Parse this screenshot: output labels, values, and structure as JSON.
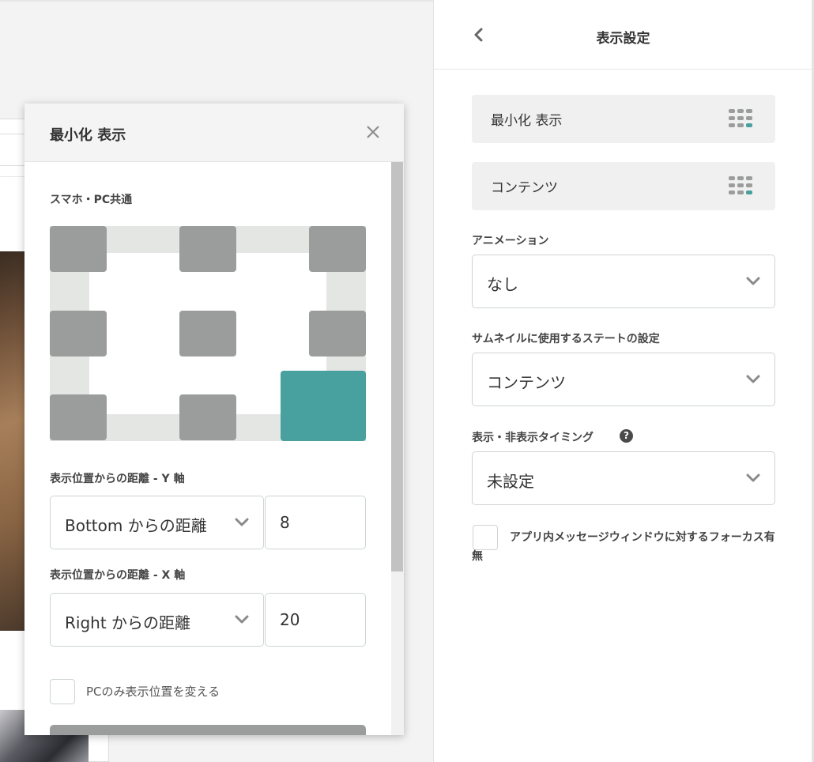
{
  "right_panel": {
    "title": "表示設定",
    "layers": [
      {
        "label": "最小化 表示"
      },
      {
        "label": "コンテンツ"
      }
    ],
    "animation": {
      "label": "アニメーション",
      "value": "なし"
    },
    "thumbnail_state": {
      "label": "サムネイルに使用するステートの設定",
      "value": "コンテンツ"
    },
    "timing": {
      "label": "表示・非表示タイミング",
      "value": "未設定",
      "help_glyph": "?"
    },
    "focus_checkbox": {
      "label": "アプリ内メッセージウィンドウに対するフォーカス有無",
      "checked": false
    }
  },
  "dialog": {
    "title": "最小化 表示",
    "close_glyph": "×",
    "section_label": "スマホ・PC共通",
    "position_grid": {
      "positions": [
        "top-left",
        "top-center",
        "top-right",
        "middle-left",
        "middle-center",
        "middle-right",
        "bottom-left",
        "bottom-center",
        "bottom-right"
      ],
      "selected": "bottom-right"
    },
    "y_axis": {
      "label": "表示位置からの距離 - Y 軸",
      "select_value": "Bottom からの距離",
      "input_value": "8"
    },
    "x_axis": {
      "label": "表示位置からの距離 - X 軸",
      "select_value": "Right からの距離",
      "input_value": "20"
    },
    "pc_checkbox": {
      "label": "PCのみ表示位置を変える",
      "checked": false
    }
  },
  "colors": {
    "accent": "#48a09f",
    "tile": "#9a9d9c",
    "frame": "#e4e6e4"
  }
}
